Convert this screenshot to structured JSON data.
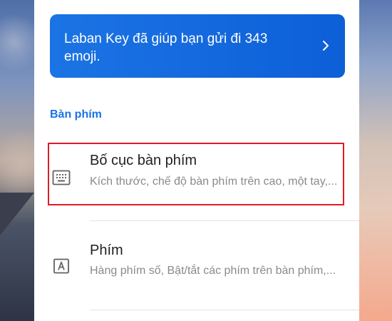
{
  "colors": {
    "accent": "#1a73e8",
    "banner": "#1b74e4",
    "highlight": "#e01b24"
  },
  "banner": {
    "text": "Laban Key đã giúp bạn gửi đi 343 emoji.",
    "icon": "chevron-right-icon"
  },
  "section": {
    "title": "Bàn phím"
  },
  "items": [
    {
      "title": "Bố cục bàn phím",
      "subtitle": "Kích thước, chế độ bàn phím trên cao, một tay,...",
      "icon": "keyboard-icon",
      "highlighted": true
    },
    {
      "title": "Phím",
      "subtitle": "Hàng phím số, Bật/tắt các phím trên bàn phím,...",
      "icon": "letter-a-key-icon",
      "highlighted": false
    }
  ]
}
